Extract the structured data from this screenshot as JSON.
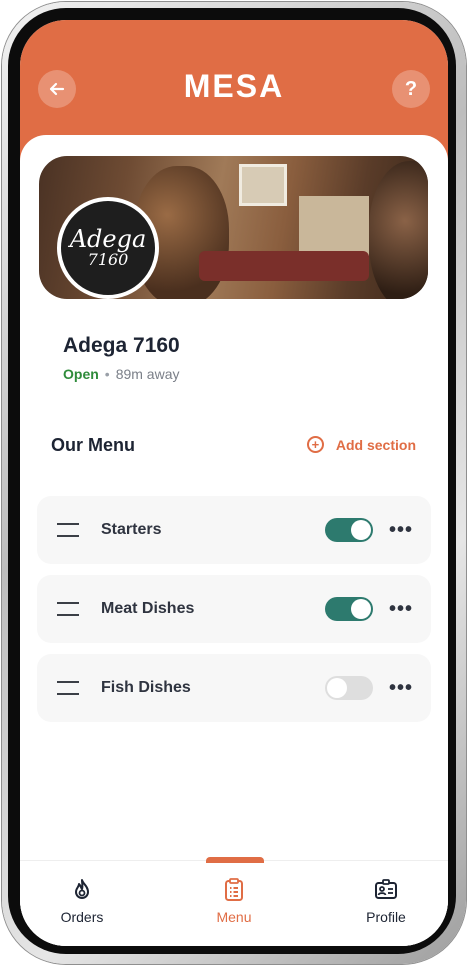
{
  "app": {
    "logo_text": "MESA",
    "back_icon": "arrow-left-icon",
    "help_label": "?",
    "accent_color": "#e06d45",
    "toggle_on_color": "#2d7a6e"
  },
  "restaurant": {
    "name": "Adega 7160",
    "logo_line1": "Adega",
    "logo_line2": "7160",
    "status": "Open",
    "distance": "89m away"
  },
  "menu": {
    "title": "Our Menu",
    "add_section_label": "Add section",
    "sections": [
      {
        "label": "Starters",
        "enabled": true
      },
      {
        "label": "Meat Dishes",
        "enabled": true
      },
      {
        "label": "Fish Dishes",
        "enabled": false
      }
    ]
  },
  "tabs": [
    {
      "label": "Orders",
      "icon": "flame-icon",
      "active": false
    },
    {
      "label": "Menu",
      "icon": "clipboard-list-icon",
      "active": true
    },
    {
      "label": "Profile",
      "icon": "id-card-icon",
      "active": false
    }
  ]
}
